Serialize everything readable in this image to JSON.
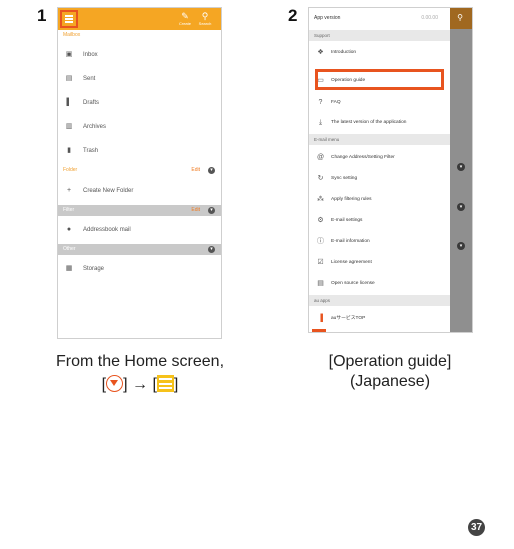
{
  "steps": {
    "one": "1",
    "two": "2"
  },
  "phone1": {
    "header_tools": [
      {
        "icon": "pencil-icon",
        "glyph": "✎",
        "label": "Create"
      },
      {
        "icon": "search-icon",
        "glyph": "⚲",
        "label": "Search"
      }
    ],
    "mailbox_header": "Mailbox",
    "mailbox_items": [
      {
        "icon": "inbox-icon",
        "glyph": "▣",
        "label": "Inbox"
      },
      {
        "icon": "sent-icon",
        "glyph": "▤",
        "label": "Sent"
      },
      {
        "icon": "drafts-icon",
        "glyph": "▌",
        "label": "Drafts"
      },
      {
        "icon": "archives-icon",
        "glyph": "▥",
        "label": "Archives"
      },
      {
        "icon": "trash-icon",
        "glyph": "▮",
        "label": "Trash"
      }
    ],
    "folder_header": "Folder",
    "folder_edit": "Edit",
    "folder_items": [
      {
        "icon": "plus-icon",
        "glyph": "+",
        "label": "Create New Folder"
      }
    ],
    "filter_header": "Filter",
    "filter_edit": "Edit",
    "filter_items": [
      {
        "icon": "filter-icon",
        "glyph": "●",
        "label": "Addressbook mail"
      }
    ],
    "other_header": "Other",
    "other_items": [
      {
        "icon": "storage-icon",
        "glyph": "▦",
        "label": "Storage"
      }
    ]
  },
  "phone2": {
    "app_version_label": "App version",
    "app_version_value": "0.00.00",
    "support_header": "Support",
    "support_items": [
      {
        "icon": "introduction-icon",
        "glyph": "❖",
        "label": "Introduction"
      },
      {
        "icon": "book-icon",
        "glyph": "▭",
        "label": "Operation guide"
      },
      {
        "icon": "question-icon",
        "glyph": "?",
        "label": "FAQ"
      },
      {
        "icon": "download-icon",
        "glyph": "⤓",
        "label": "The latest version of the application"
      }
    ],
    "email_header": "E-mail menu",
    "email_items": [
      {
        "icon": "at-icon",
        "glyph": "@",
        "label": "Change Address/Setting Filter"
      },
      {
        "icon": "sync-icon",
        "glyph": "↻",
        "label": "Sync setting"
      },
      {
        "icon": "filter-rules-icon",
        "glyph": "⁂",
        "label": "Apply filtering rules"
      },
      {
        "icon": "settings-icon",
        "glyph": "⚙",
        "label": "E-mail settings"
      },
      {
        "icon": "info-icon",
        "glyph": "ⓘ",
        "label": "E-mail information"
      },
      {
        "icon": "license-icon",
        "glyph": "☑",
        "label": "License agreement"
      },
      {
        "icon": "open-source-icon",
        "glyph": "▤",
        "label": "Open source license"
      }
    ],
    "au_header": "au apps",
    "au_items": [
      {
        "icon": "au-icon",
        "glyph": "▐",
        "label": "auサービスTOP"
      }
    ]
  },
  "captions": {
    "step1_line1": "From the Home screen,",
    "bracket_open": "[",
    "bracket_close": "]",
    "arrow": "→",
    "step2_line1": "[Operation guide]",
    "step2_line2": "(Japanese)"
  },
  "page_number": "37",
  "colors": {
    "accent_orange": "#f5a623",
    "highlight_red": "#e8541f",
    "menu_yellow": "#f6c21a"
  }
}
